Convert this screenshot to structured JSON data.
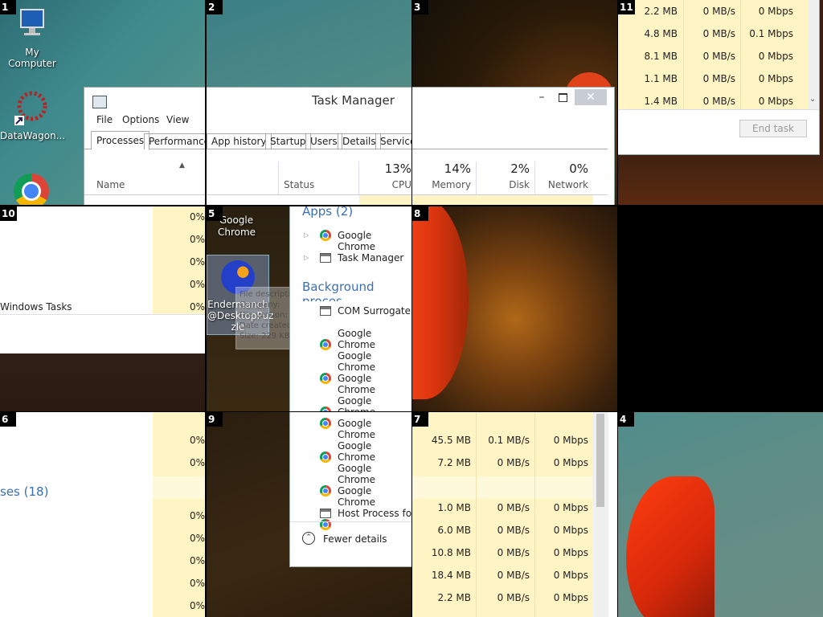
{
  "tile_numbers": [
    "1",
    "2",
    "3",
    "11",
    "10",
    "5",
    "8",
    "6",
    "9",
    "7",
    "4"
  ],
  "desktop": {
    "my_computer": "My Computer",
    "datawagon": "DataWagon...",
    "google_chrome": "Google Chrome",
    "endermanch_l1": "Endermanch",
    "endermanch_l2": "@DesktopPuz",
    "endermanch_l3": "zle",
    "tooltip_lines": [
      "File description:",
      "Company:",
      "File version:",
      "Date created:",
      "Size: 229 KB"
    ]
  },
  "task_manager": {
    "title": "Task Manager",
    "menu": [
      "File",
      "Options",
      "View"
    ],
    "tabs": [
      "Processes",
      "Performance",
      "App history",
      "Startup",
      "Users",
      "Details",
      "Services"
    ],
    "columns": {
      "name": "Name",
      "status": "Status",
      "cpu_pct": "13%",
      "cpu": "CPU",
      "memory_pct": "14%",
      "memory": "Memory",
      "disk_pct": "2%",
      "disk": "Disk",
      "network_pct": "0%",
      "network": "Network"
    },
    "apps_group": "Apps (2)",
    "apps": [
      "Google Chrome",
      "Task Manager"
    ],
    "background_group": "Background proces",
    "background_group_tail": "ses (18)",
    "background": [
      "COM Surrogate",
      "Google Chrome",
      "Google Chrome",
      "Google Chrome",
      "Google Chrome",
      "Google Chrome",
      "Google Chrome",
      "Google Chrome",
      "Google Chrome",
      "Host Process for W"
    ],
    "windows_tasks": "Windows Tasks",
    "cpu_zero": "0%",
    "fewer_details": "Fewer details",
    "end_task": "End task",
    "rows_top": [
      {
        "mem": "2.2 MB",
        "disk": "0 MB/s",
        "net": "0 Mbps"
      },
      {
        "mem": "4.8 MB",
        "disk": "0 MB/s",
        "net": "0.1 Mbps"
      },
      {
        "mem": "8.1 MB",
        "disk": "0 MB/s",
        "net": "0 Mbps"
      },
      {
        "mem": "1.1 MB",
        "disk": "0 MB/s",
        "net": "0 Mbps"
      },
      {
        "mem": "1.4 MB",
        "disk": "0 MB/s",
        "net": "0 Mbps"
      }
    ],
    "rows_bottom": [
      {
        "mem": "45.5 MB",
        "disk": "0.1 MB/s",
        "net": "0 Mbps"
      },
      {
        "mem": "7.2 MB",
        "disk": "0 MB/s",
        "net": "0 Mbps"
      },
      {
        "mem": "",
        "disk": "",
        "net": ""
      },
      {
        "mem": "1.0 MB",
        "disk": "0 MB/s",
        "net": "0 Mbps"
      },
      {
        "mem": "6.0 MB",
        "disk": "0 MB/s",
        "net": "0 Mbps"
      },
      {
        "mem": "10.8 MB",
        "disk": "0 MB/s",
        "net": "0 Mbps"
      },
      {
        "mem": "18.4 MB",
        "disk": "0 MB/s",
        "net": "0 Mbps"
      },
      {
        "mem": "2.2 MB",
        "disk": "0 MB/s",
        "net": "0 Mbps"
      }
    ]
  },
  "colors": {
    "accent": "#3a6fb5",
    "highlight": "#fff4c4",
    "desktop": "#2b5a5e"
  }
}
